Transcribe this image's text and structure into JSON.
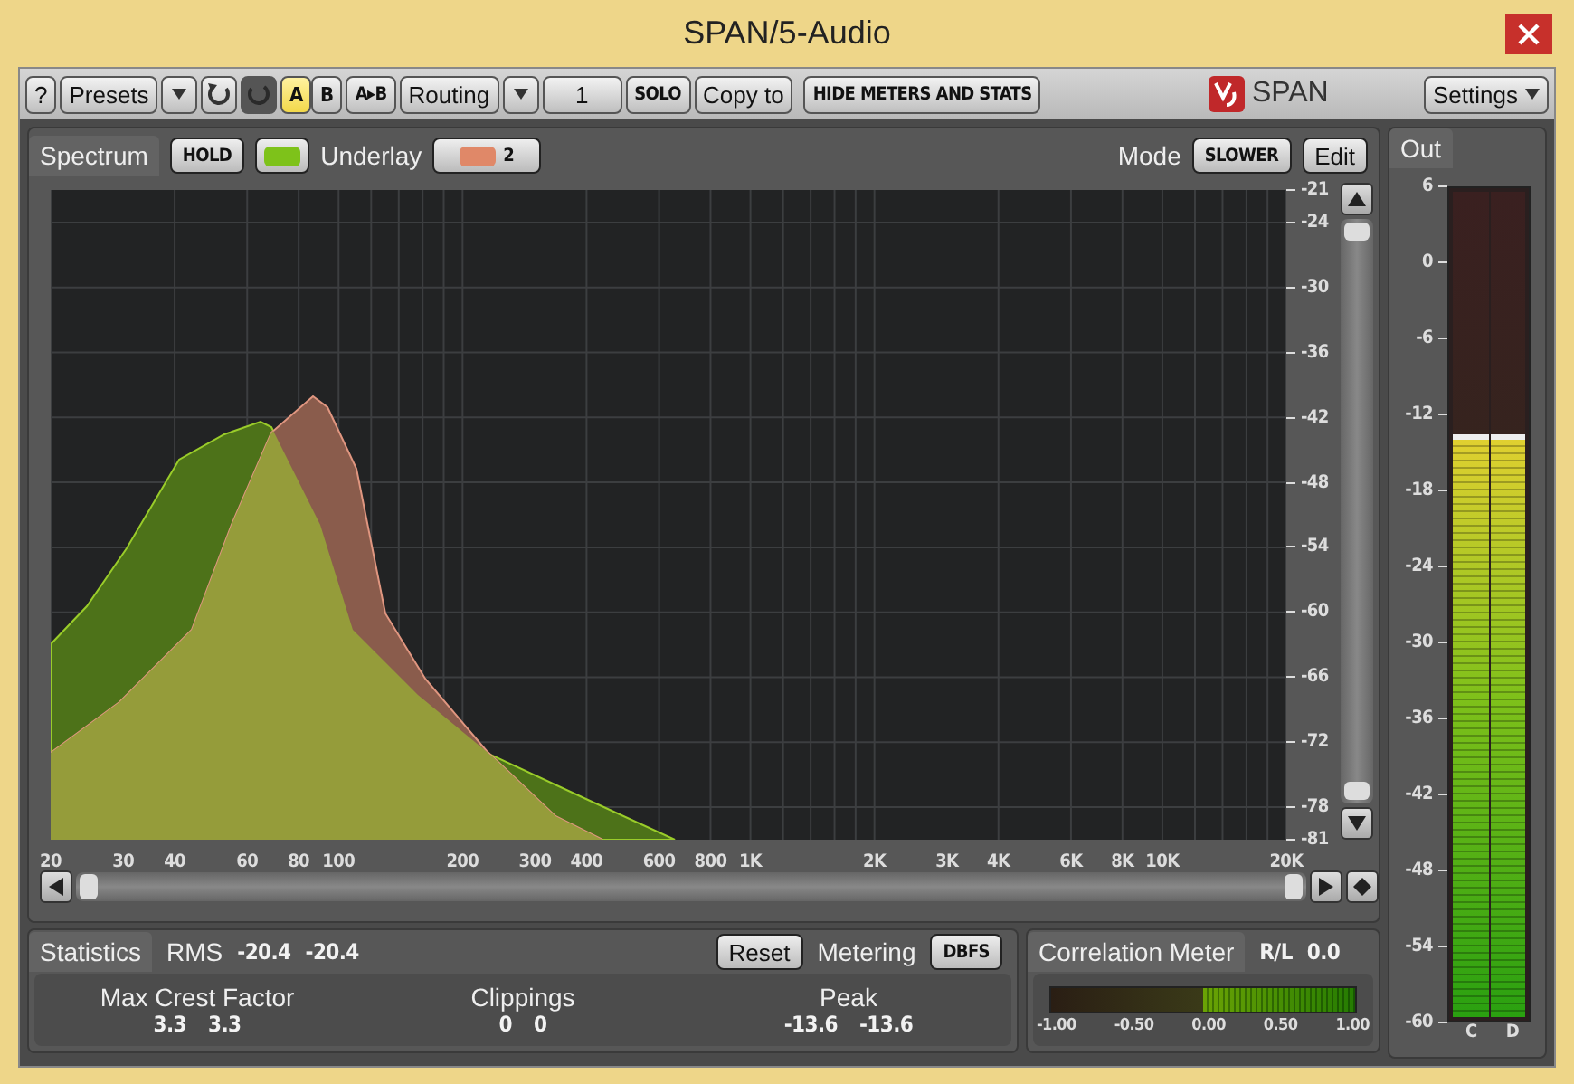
{
  "window": {
    "title": "SPAN/5-Audio"
  },
  "toolbar": {
    "help": "?",
    "presets": "Presets",
    "ab": [
      {
        "label": "A",
        "selected": true
      },
      {
        "label": "B",
        "selected": false
      }
    ],
    "copy_ab": "A▸B",
    "routing": "Routing",
    "channel": "1",
    "solo": "SOLO",
    "copy_to": "Copy to",
    "hide": "HIDE METERS AND STATS",
    "logo": "SPAN",
    "settings": "Settings"
  },
  "spectrum": {
    "title": "Spectrum",
    "hold": "HOLD",
    "underlay_label": "Underlay",
    "underlay_value": "2",
    "mode_label": "Mode",
    "mode": "SLOWER",
    "edit": "Edit",
    "y_labels": [
      "-21",
      "-24",
      "-30",
      "-36",
      "-42",
      "-48",
      "-54",
      "-60",
      "-66",
      "-72",
      "-78",
      "-81"
    ],
    "x_labels": [
      "20",
      "30",
      "40",
      "60",
      "80",
      "100",
      "200",
      "300",
      "400",
      "600",
      "800",
      "1K",
      "2K",
      "3K",
      "4K",
      "6K",
      "8K",
      "10K",
      "20K"
    ]
  },
  "out": {
    "title": "Out",
    "level": 0.7,
    "scale": [
      "6",
      "0",
      "-6",
      "-12",
      "-18",
      "-24",
      "-30",
      "-36",
      "-42",
      "-48",
      "-54",
      "-60"
    ],
    "channels": [
      "C",
      "D"
    ]
  },
  "statistics": {
    "title": "Statistics",
    "rms_label": "RMS",
    "rms": [
      "-20.4",
      "-20.4"
    ],
    "reset": "Reset",
    "metering_label": "Metering",
    "metering": "DBFS",
    "stats": [
      {
        "label": "Max Crest Factor",
        "values": [
          "3.3",
          "3.3"
        ]
      },
      {
        "label": "Clippings",
        "values": [
          "0",
          "0"
        ]
      },
      {
        "label": "Peak",
        "values": [
          "-13.6",
          "-13.6"
        ]
      }
    ]
  },
  "correlation": {
    "title": "Correlation Meter",
    "channel": "R/L",
    "value": "0.0",
    "scale": [
      "-1.00",
      "-0.50",
      "0.00",
      "0.50",
      "1.00"
    ]
  }
}
